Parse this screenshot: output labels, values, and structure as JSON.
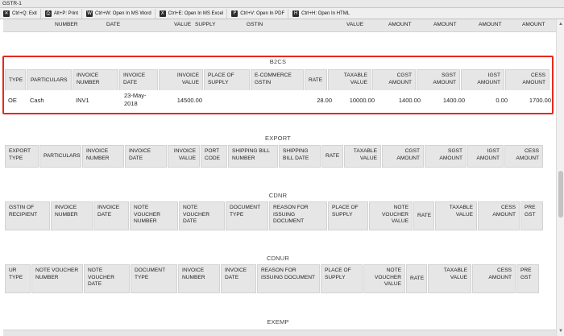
{
  "window": {
    "title": "GSTR-1"
  },
  "toolbar": [
    {
      "icon": "close-icon",
      "glyph": "✕",
      "label": "Ctrl+Q: Exit"
    },
    {
      "icon": "print-icon",
      "glyph": "⎙",
      "label": "Alt+P: Print"
    },
    {
      "icon": "word-icon",
      "glyph": "W",
      "label": "Ctrl+W: Open In MS Word"
    },
    {
      "icon": "excel-icon",
      "glyph": "X",
      "label": "Ctrl+E: Open In MS Excel"
    },
    {
      "icon": "pdf-icon",
      "glyph": "P",
      "label": "Ctrl+V: Open In PDF"
    },
    {
      "icon": "html-icon",
      "glyph": "H",
      "label": "Ctrl+H: Open In HTML"
    }
  ],
  "partial_header": [
    "NUMBER",
    "DATE",
    "VALUE",
    "SUPPLY",
    "GSTIN",
    "VALUE",
    "AMOUNT",
    "AMOUNT",
    "AMOUNT",
    "AMOUNT"
  ],
  "sections": {
    "b2cs": {
      "title": "B2CS",
      "headers": [
        "TYPE",
        "PARTICULARS",
        "INVOICE NUMBER",
        "INVOICE DATE",
        "INVOICE VALUE",
        "PLACE OF SUPPLY",
        "E-COMMERCE GSTIN",
        "RATE",
        "TAXABLE VALUE",
        "CGST AMOUNT",
        "SGST AMOUNT",
        "IGST AMOUNT",
        "CESS AMOUNT"
      ],
      "row": {
        "type": "OE",
        "particulars": "Cash",
        "invoice_number": "INV1",
        "invoice_date": "23-May-2018",
        "invoice_value": "14500.00",
        "place_of_supply": "",
        "ecommerce_gstin": "",
        "rate": "28.00",
        "taxable_value": "10000.00",
        "cgst": "1400.00",
        "sgst": "1400.00",
        "igst": "0.00",
        "cess": "1700.00"
      }
    },
    "export": {
      "title": "EXPORT",
      "headers": [
        "EXPORT TYPE",
        "PARTICULARS",
        "INVOICE NUMBER",
        "INVOICE DATE",
        "INVOICE VALUE",
        "PORT CODE",
        "SHIPPING BILL NUMBER",
        "SHIPPING BILL DATE",
        "RATE",
        "TAXABLE VALUE",
        "CGST AMOUNT",
        "SGST AMOUNT",
        "IGST AMOUNT",
        "CESS AMOUNT"
      ]
    },
    "cdnr": {
      "title": "CDNR",
      "headers": [
        "GSTIN OF RECIPIENT",
        "INVOICE NUMBER",
        "INVOICE DATE",
        "NOTE VOUCHER NUMBER",
        "NOTE VOUCHER DATE",
        "DOCUMENT TYPE",
        "REASON FOR ISSUING DOCUMENT",
        "PLACE OF SUPPLY",
        "NOTE VOUCHER VALUE",
        "RATE",
        "TAXABLE VALUE",
        "CESS AMOUNT",
        "PRE GST"
      ]
    },
    "cdnur": {
      "title": "CDNUR",
      "headers": [
        "UR TYPE",
        "NOTE VOUCHER NUMBER",
        "NOTE VOUCHER DATE",
        "DOCUMENT TYPE",
        "INVOICE NUMBER",
        "INVOICE DATE",
        "REASON FOR ISSUING DOCUMENT",
        "PLACE OF SUPPLY",
        "NOTE VOUCHER VALUE",
        "RATE",
        "TAXABLE VALUE",
        "CESS AMOUNT",
        "PRE GST"
      ]
    },
    "exemp": {
      "title": "EXEMP"
    }
  },
  "colors": {
    "highlight": "#e8291c",
    "header_bg": "#e6e6e6"
  }
}
